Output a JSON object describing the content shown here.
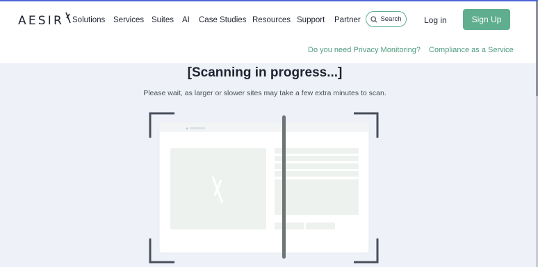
{
  "header": {
    "logo_text": "AESIR",
    "nav": [
      {
        "label": "Solutions"
      },
      {
        "label": "Services"
      },
      {
        "label": "Suites"
      },
      {
        "label": "AI"
      },
      {
        "label": "Case Studies"
      },
      {
        "label": "Resources"
      },
      {
        "label": "Support"
      },
      {
        "label": "Partner"
      }
    ],
    "search_label": "Search",
    "login_label": "Log in",
    "signup_label": "Sign Up",
    "subnav": [
      {
        "label": "Do you need Privacy Monitoring?"
      },
      {
        "label": "Compliance as a Service"
      }
    ]
  },
  "main": {
    "title": "[Scanning in progress...]",
    "subtitle": "Please wait, as larger or slower sites may take a few extra minutes to scan."
  },
  "colors": {
    "accent": "#5fae8f",
    "background": "#eef1f8"
  },
  "icons": [
    "search-icon",
    "logo-mark-icon",
    "image-placeholder-icon"
  ]
}
